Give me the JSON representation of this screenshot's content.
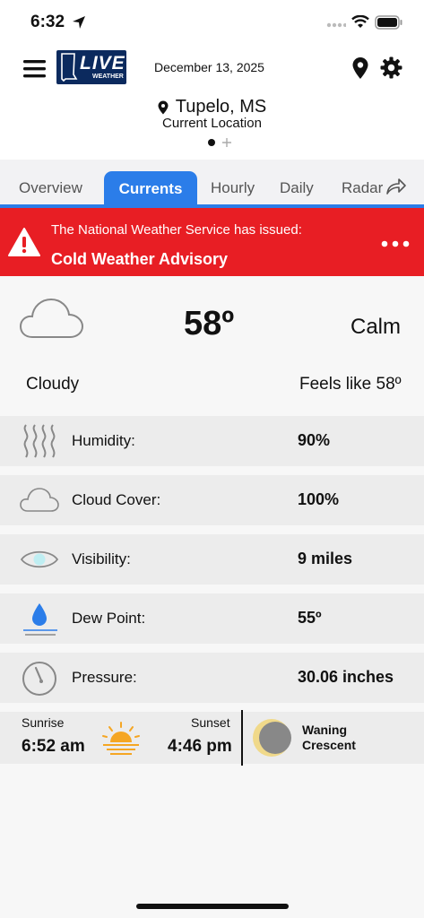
{
  "status_bar": {
    "time": "6:32"
  },
  "header": {
    "logo_text": "LIVE",
    "logo_sub": "WEATHER",
    "date": "December 13, 2025"
  },
  "location": {
    "city": "Tupelo, MS",
    "subtitle": "Current Location"
  },
  "tabs": [
    {
      "label": "Overview"
    },
    {
      "label": "Currents",
      "active": true
    },
    {
      "label": "Hourly"
    },
    {
      "label": "Daily"
    },
    {
      "label": "Radar"
    }
  ],
  "alert": {
    "line1": "The National Weather Service has issued:",
    "line2": "Cold Weather Advisory"
  },
  "current": {
    "temp": "58º",
    "wind": "Calm",
    "condition": "Cloudy",
    "feels_like": "Feels like 58º"
  },
  "details": [
    {
      "label": "Humidity:",
      "value": "90%",
      "icon": "humidity-icon"
    },
    {
      "label": "Cloud Cover:",
      "value": "100%",
      "icon": "cloud-icon"
    },
    {
      "label": "Visibility:",
      "value": "9 miles",
      "icon": "eye-icon"
    },
    {
      "label": "Dew Point:",
      "value": "55º",
      "icon": "water-drop-icon"
    },
    {
      "label": "Pressure:",
      "value": "30.06 inches",
      "icon": "gauge-icon"
    }
  ],
  "sun": {
    "sunrise_label": "Sunrise",
    "sunrise": "6:52 am",
    "sunset_label": "Sunset",
    "sunset": "4:46 pm"
  },
  "moon": {
    "phase_line1": "Waning",
    "phase_line2": "Crescent"
  },
  "colors": {
    "accent": "#2b7de9",
    "alert": "#e81e24",
    "sun": "#f5a623",
    "moon": "#f0d98a"
  }
}
